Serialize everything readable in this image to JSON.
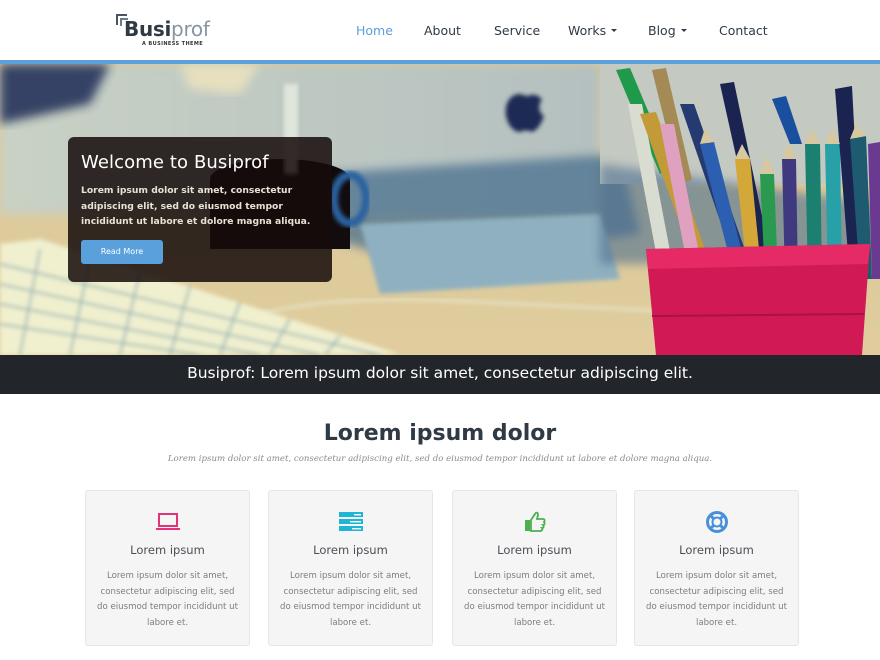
{
  "brand": {
    "name_bold": "Busi",
    "name_light": "prof",
    "subtitle": "A BUSINESS THEME"
  },
  "nav": {
    "items": [
      {
        "label": "Home",
        "active": true,
        "dropdown": false
      },
      {
        "label": "About",
        "active": false,
        "dropdown": false
      },
      {
        "label": "Service",
        "active": false,
        "dropdown": false
      },
      {
        "label": "Works",
        "active": false,
        "dropdown": true
      },
      {
        "label": "Blog",
        "active": false,
        "dropdown": true
      },
      {
        "label": "Contact",
        "active": false,
        "dropdown": false
      }
    ]
  },
  "hero": {
    "title": "Welcome to Busiprof",
    "text": "Lorem ipsum dolor sit amet, consectetur adipiscing elit, sed do eiusmod tempor incididunt ut labore et dolore magna aliqua.",
    "button_label": "Read More"
  },
  "tagline": "Busiprof: Lorem ipsum dolor sit amet, consectetur adipiscing elit.",
  "services": {
    "title": "Lorem ipsum dolor",
    "subtitle": "Lorem ipsum dolor sit amet, consectetur adipiscing elit, sed do eiusmod tempor incididunt ut labore et dolore magna aliqua.",
    "cards": [
      {
        "icon": "laptop-icon",
        "color": "#e5337a",
        "title": "Lorem ipsum",
        "text": "Lorem ipsum dolor sit amet, consectetur adipiscing elit, sed do eiusmod tempor incididunt ut labore et."
      },
      {
        "icon": "server-icon",
        "color": "#1fb5d6",
        "title": "Lorem ipsum",
        "text": "Lorem ipsum dolor sit amet, consectetur adipiscing elit, sed do eiusmod tempor incididunt ut labore et."
      },
      {
        "icon": "thumbs-up-icon",
        "color": "#4caf50",
        "title": "Lorem ipsum",
        "text": "Lorem ipsum dolor sit amet, consectetur adipiscing elit, sed do eiusmod tempor incididunt ut labore et."
      },
      {
        "icon": "life-ring-icon",
        "color": "#4a90d9",
        "title": "Lorem ipsum",
        "text": "Lorem ipsum dolor sit amet, consectetur adipiscing elit, sed do eiusmod tempor incididunt ut labore et."
      }
    ]
  },
  "colors": {
    "accent": "#5aa0dc",
    "tagline_bg": "#22252a",
    "heading": "#2f3a45"
  }
}
